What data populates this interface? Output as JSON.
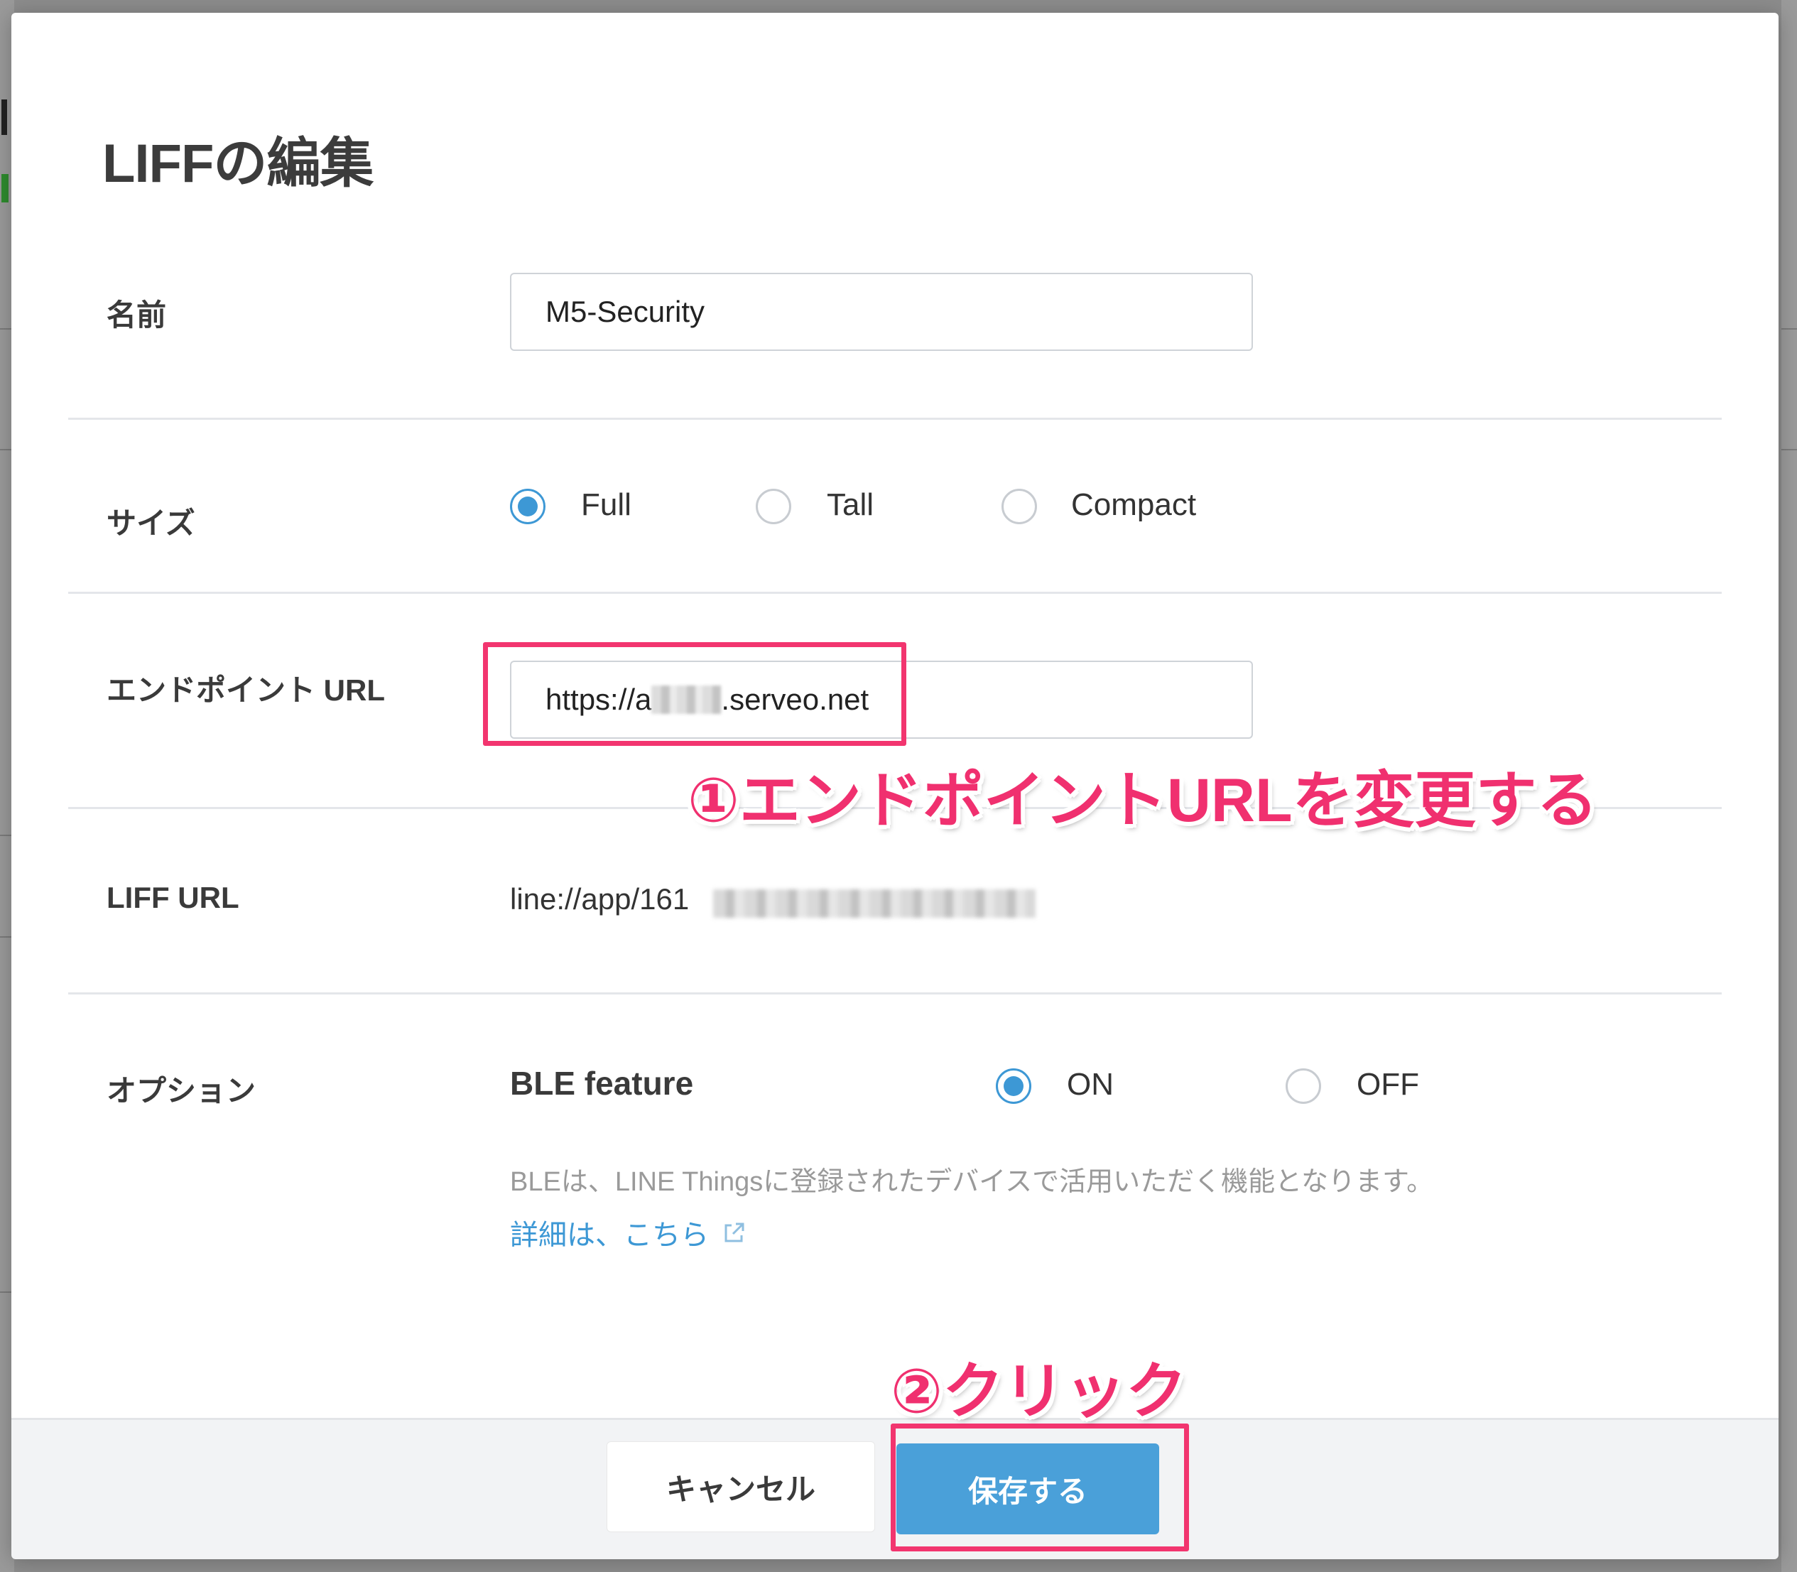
{
  "modal": {
    "title": "LIFFの編集"
  },
  "name_row": {
    "label": "名前",
    "value": "M5-Security"
  },
  "size_row": {
    "label": "サイズ",
    "options": [
      "Full",
      "Tall",
      "Compact"
    ],
    "selected": "Full"
  },
  "endpoint_row": {
    "label": "エンドポイント URL",
    "value_prefix": "https://a",
    "value_suffix": ".serveo.net"
  },
  "liff_url_row": {
    "label": "LIFF URL",
    "value_prefix": "line://app/161"
  },
  "options_row": {
    "label": "オプション",
    "feature_name": "BLE feature",
    "on_label": "ON",
    "off_label": "OFF",
    "selected": "ON",
    "help_text": "BLEは、LINE Thingsに登録されたデバイスで活用いただく機能となります。",
    "help_link": "詳細は、こちら"
  },
  "footer": {
    "cancel_label": "キャンセル",
    "save_label": "保存する"
  },
  "annotations": {
    "step1": "①エンドポイントURLを変更する",
    "step2": "②クリック"
  },
  "icons": {
    "external_link": "external-link-icon",
    "radio_checked": "radio-checked-icon",
    "radio_unchecked": "radio-unchecked-icon"
  },
  "colors": {
    "accent": "#3d98d5",
    "annotation": "#f0306f",
    "save_button": "#4aa0d9"
  }
}
